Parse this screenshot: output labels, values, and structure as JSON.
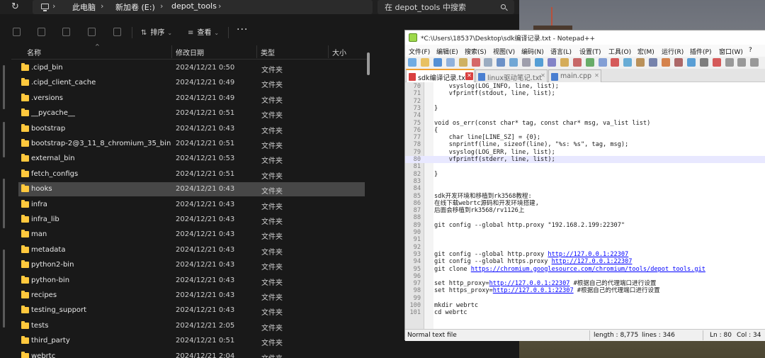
{
  "explorer": {
    "breadcrumb": [
      "此电脑",
      "新加卷 (E:)",
      "depot_tools"
    ],
    "search_placeholder": "在 depot_tools 中搜索",
    "toolbar": {
      "sort_label": "排序",
      "view_label": "查看",
      "more_label": "···"
    },
    "columns": {
      "name": "名称",
      "date": "修改日期",
      "type": "类型",
      "size": "大小"
    },
    "rows": [
      {
        "name": ".cipd_bin",
        "date": "2024/12/21 0:50",
        "type": "文件夹"
      },
      {
        "name": ".cipd_client_cache",
        "date": "2024/12/21 0:49",
        "type": "文件夹"
      },
      {
        "name": ".versions",
        "date": "2024/12/21 0:49",
        "type": "文件夹"
      },
      {
        "name": "__pycache__",
        "date": "2024/12/21 0:51",
        "type": "文件夹"
      },
      {
        "name": "bootstrap",
        "date": "2024/12/21 0:43",
        "type": "文件夹"
      },
      {
        "name": "bootstrap-2@3_11_8_chromium_35_bin",
        "date": "2024/12/21 0:51",
        "type": "文件夹"
      },
      {
        "name": "external_bin",
        "date": "2024/12/21 0:53",
        "type": "文件夹"
      },
      {
        "name": "fetch_configs",
        "date": "2024/12/21 0:51",
        "type": "文件夹"
      },
      {
        "name": "hooks",
        "date": "2024/12/21 0:43",
        "type": "文件夹",
        "selected": true
      },
      {
        "name": "infra",
        "date": "2024/12/21 0:43",
        "type": "文件夹"
      },
      {
        "name": "infra_lib",
        "date": "2024/12/21 0:43",
        "type": "文件夹"
      },
      {
        "name": "man",
        "date": "2024/12/21 0:43",
        "type": "文件夹"
      },
      {
        "name": "metadata",
        "date": "2024/12/21 0:43",
        "type": "文件夹"
      },
      {
        "name": "python2-bin",
        "date": "2024/12/21 0:43",
        "type": "文件夹"
      },
      {
        "name": "python-bin",
        "date": "2024/12/21 0:43",
        "type": "文件夹"
      },
      {
        "name": "recipes",
        "date": "2024/12/21 0:43",
        "type": "文件夹"
      },
      {
        "name": "testing_support",
        "date": "2024/12/21 0:43",
        "type": "文件夹"
      },
      {
        "name": "tests",
        "date": "2024/12/21 2:05",
        "type": "文件夹"
      },
      {
        "name": "third_party",
        "date": "2024/12/21 0:51",
        "type": "文件夹"
      },
      {
        "name": "webrtc",
        "date": "2024/12/21 2:04",
        "type": "文件夹"
      }
    ]
  },
  "notepad": {
    "title": "*C:\\Users\\18537\\Desktop\\sdk编译记录.txt - Notepad++",
    "menu": [
      "文件(F)",
      "编辑(E)",
      "搜索(S)",
      "视图(V)",
      "编码(N)",
      "语言(L)",
      "设置(T)",
      "工具(O)",
      "宏(M)",
      "运行(R)",
      "插件(P)",
      "窗口(W)",
      "?"
    ],
    "tabs": [
      {
        "label": "sdk编译记录.txt",
        "active": true
      },
      {
        "label": "linux驱动笔记.txt",
        "active": false
      },
      {
        "label": "main.cpp",
        "active": false
      }
    ],
    "lines": [
      {
        "n": "70",
        "t": "    vsyslog(LOG_INFO, line, list);"
      },
      {
        "n": "71",
        "t": "    vfprintf(stdout, line, list);"
      },
      {
        "n": "72",
        "t": ""
      },
      {
        "n": "73",
        "t": "}"
      },
      {
        "n": "74",
        "t": ""
      },
      {
        "n": "75",
        "t": "void os_err(const char* tag, const char* msg, va_list list)"
      },
      {
        "n": "76",
        "t": "{"
      },
      {
        "n": "77",
        "t": "    char line[LINE_SZ] = {0};"
      },
      {
        "n": "78",
        "t": "    snprintf(line, sizeof(line), \"%s: %s\", tag, msg);"
      },
      {
        "n": "79",
        "t": "    vsyslog(LOG_ERR, line, list);"
      },
      {
        "n": "80",
        "t": "    vfprintf(stderr, line, list);",
        "current": true
      },
      {
        "n": "81",
        "t": ""
      },
      {
        "n": "82",
        "t": "}"
      },
      {
        "n": "83",
        "t": ""
      },
      {
        "n": "84",
        "t": ""
      },
      {
        "n": "85",
        "t": "sdk开发环境和移植到rk3568教程:"
      },
      {
        "n": "86",
        "t": "在线下载webrtc源码和开发环境搭建,"
      },
      {
        "n": "87",
        "t": "后面会移植到rk3568/rv1126上"
      },
      {
        "n": "88",
        "t": ""
      },
      {
        "n": "89",
        "t": "git config --global http.proxy \"192.168.2.199:22307\""
      },
      {
        "n": "90",
        "t": ""
      },
      {
        "n": "91",
        "t": ""
      },
      {
        "n": "92",
        "t": ""
      },
      {
        "n": "93",
        "t": "git config --global http.proxy ",
        "link": "http://127.0.0.1:22307"
      },
      {
        "n": "94",
        "t": "git config --global https.proxy ",
        "link": "http://127.0.0.1:22307"
      },
      {
        "n": "95",
        "t": "git clone ",
        "link": "https://chromium.googlesource.com/chromium/tools/depot_tools.git"
      },
      {
        "n": "96",
        "t": ""
      },
      {
        "n": "97",
        "t": "set http_proxy=",
        "link": "http://127.0.0.1:22307",
        "tail": " #根据自己的代理端口进行设置"
      },
      {
        "n": "98",
        "t": "set https_proxy=",
        "link": "http://127.0.0.1:22307",
        "tail": " #根据自己的代理端口进行设置"
      },
      {
        "n": "99",
        "t": ""
      },
      {
        "n": "100",
        "t": "mkdir webrtc"
      },
      {
        "n": "101",
        "t": "cd webrtc"
      }
    ],
    "status": {
      "filetype": "Normal text file",
      "length": "length : 8,775",
      "lines": "lines : 346",
      "ln": "Ln : 80",
      "col": "Col : 34"
    }
  },
  "colors": {
    "folder": "#ffc83d",
    "selected_row": "#474747",
    "current_line": "#e8e8ff",
    "link": "#0000ff",
    "active_tab_accent": "#f0a030"
  }
}
